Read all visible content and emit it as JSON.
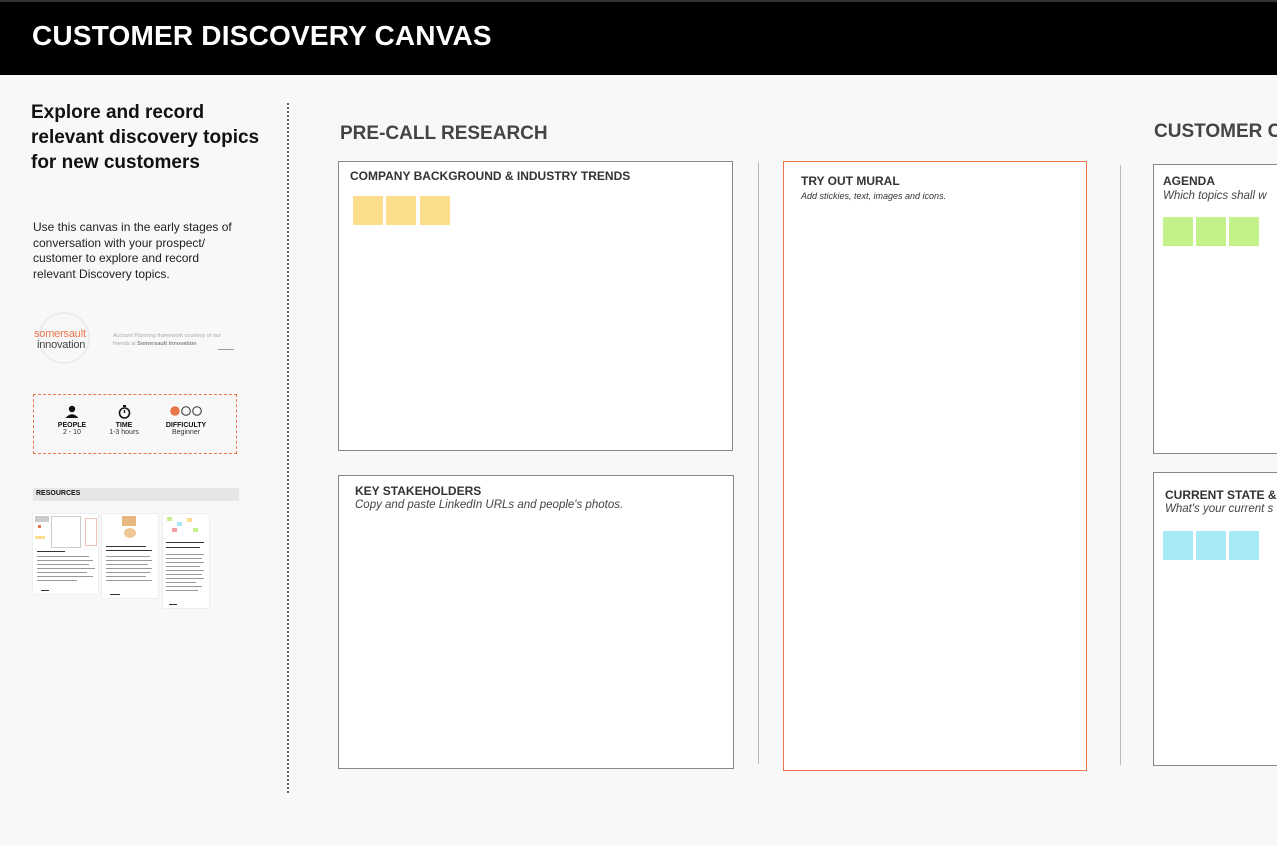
{
  "header": {
    "title": "CUSTOMER DISCOVERY CANVAS"
  },
  "intro": {
    "heading": "Explore and record relevant discovery topics for new customers",
    "body": "Use this canvas in the early stages of conversation with your prospect/ customer to explore and record relevant Discovery topics."
  },
  "logo": {
    "line1": "somersault",
    "line2": "innovation",
    "credit_prefix": "Account Planning framework courtesy of our friends at ",
    "credit_name": "Somersault Innovation"
  },
  "stats": {
    "people": {
      "icon": "person-icon",
      "label": "PEOPLE",
      "value": "2 - 10"
    },
    "time": {
      "icon": "stopwatch-icon",
      "label": "TIME",
      "value": "1-3 hours"
    },
    "difficulty": {
      "icon": "difficulty-dots-icon",
      "label": "DIFFICULTY",
      "value": "Beginner",
      "level": 1,
      "max": 3
    }
  },
  "resources": {
    "label": "RESOURCES"
  },
  "precall": {
    "title": "PRE-CALL RESEARCH",
    "company": {
      "title": "COMPANY BACKGROUND & INDUSTRY TRENDS"
    },
    "stakeholders": {
      "title": "KEY STAKEHOLDERS",
      "subtitle": "Copy and paste LinkedIn URLs and people's photos."
    }
  },
  "mural": {
    "title": "TRY OUT MURAL",
    "subtitle": "Add stickies, text, images and icons."
  },
  "customer": {
    "title": "CUSTOMER C",
    "agenda": {
      "title": "AGENDA",
      "subtitle": "Which topics shall w"
    },
    "current_state": {
      "title": "CURRENT STATE & I",
      "subtitle": "What's your current s"
    }
  },
  "colors": {
    "header_bg": "#000000",
    "accent": "#e8764a",
    "sticky_yellow": "#fdde8c",
    "sticky_green": "#c4f28a",
    "sticky_cyan": "#a6e9f7"
  }
}
